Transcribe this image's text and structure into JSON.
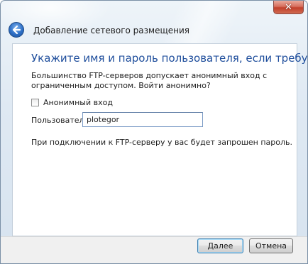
{
  "window": {
    "title": "Добавление сетевого размещения",
    "close_glyph": "✕",
    "close_icon": "close-icon",
    "back_icon": "back-arrow-icon"
  },
  "content": {
    "heading": "Укажите имя и пароль пользователя, если требуется",
    "description": "Большинство FTP-серверов допускает анонимный вход с ограниченным доступом. Войти анонимно?",
    "anonymous_checkbox": {
      "label": "Анонимный вход",
      "checked": false
    },
    "user_label": "Пользователь:",
    "user_value": "plotegor",
    "note": "При подключении к FTP-серверу у вас будет запрошен пароль."
  },
  "footer": {
    "next_label": "Далее",
    "cancel_label": "Отмена"
  },
  "colors": {
    "heading": "#1f4e9c",
    "frame": "#d7e3ef",
    "close": "#c2402c"
  }
}
